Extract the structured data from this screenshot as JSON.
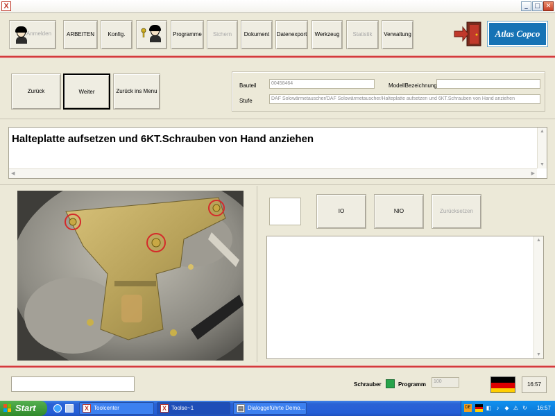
{
  "window": {
    "app_icon": "X",
    "minimize": "_",
    "maximize": "□",
    "close": "✕"
  },
  "toolbar": {
    "anmelden": "Anmelden",
    "arbeiten": "ARBEITEN",
    "konfig": "Konfig.",
    "programme": "Programme",
    "sichern": "Sichern",
    "dokument": "Dokument",
    "datenexport": "Datenexport",
    "werkzeug": "Werkzeug",
    "statistik": "Statistik",
    "verwaltung": "Verwaltung",
    "brand": "Atlas Copco"
  },
  "nav": {
    "zurueck": "Zurück",
    "weiter": "Weiter",
    "menu": "Zurück ins Menu"
  },
  "info": {
    "bauteil_label": "Bauteil",
    "bauteil_value": "00458464",
    "modell_label": "ModellBezeichnung",
    "modell_value": "",
    "stufe_label": "Stufe",
    "stufe_value": "DAF Solowärmetauscher/DAF Solowärmetauscher/Halteplatte aufsetzen und 6KT.Schrauben von Hand anziehen"
  },
  "instruction": {
    "text": "Halteplatte aufsetzen und 6KT.Schrauben von Hand anziehen"
  },
  "actions": {
    "io": "IO",
    "nio": "NIO",
    "reset": "Zurücksetzen"
  },
  "status": {
    "schrauber": "Schrauber",
    "programm": "Programm",
    "programm_value": "100",
    "time": "16:57"
  },
  "colors": {
    "accent_red": "#d33b3b",
    "status_green": "#27a34a",
    "taskbar_blue": "#245ed6"
  },
  "taskbar": {
    "start": "Start",
    "tasks": [
      "Toolcenter",
      "Toolse~1",
      "Dialoggeführte Demo..."
    ],
    "tray_lang": "DE",
    "clock": "16:57"
  }
}
